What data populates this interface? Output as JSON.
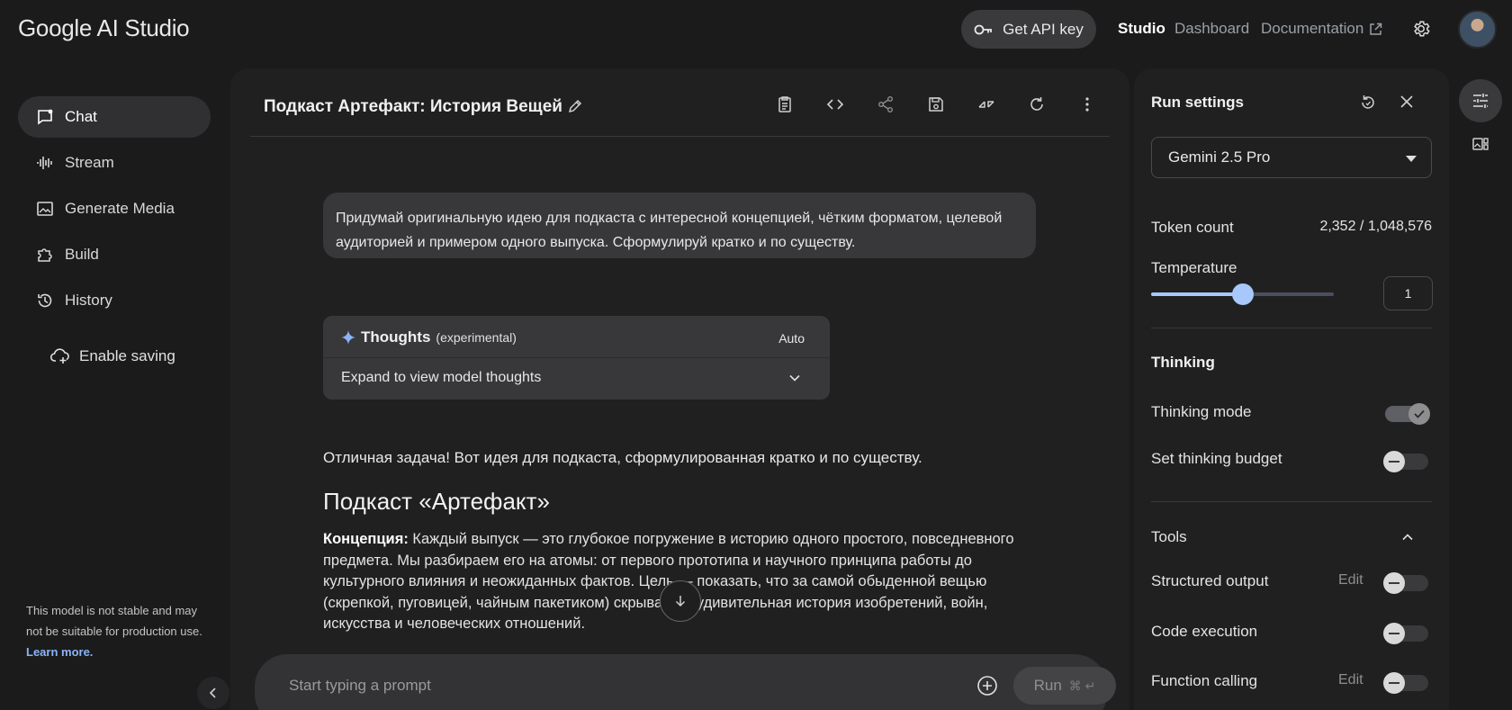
{
  "app": {
    "title": "Google AI Studio"
  },
  "header": {
    "api_key_label": "Get API key",
    "nav": [
      {
        "label": "Studio",
        "active": true
      },
      {
        "label": "Dashboard",
        "active": false
      },
      {
        "label": "Documentation",
        "active": false
      }
    ]
  },
  "sidebar": {
    "items": [
      {
        "label": "Chat",
        "icon": "chat-icon",
        "active": true
      },
      {
        "label": "Stream",
        "icon": "waveform-icon",
        "active": false
      },
      {
        "label": "Generate Media",
        "icon": "image-icon",
        "active": false
      },
      {
        "label": "Build",
        "icon": "puzzle-icon",
        "active": false
      },
      {
        "label": "History",
        "icon": "history-icon",
        "active": false
      }
    ],
    "enable_saving": "Enable saving",
    "disclaimer": "This model is not stable and may not be suitable for production use.",
    "learn_more": "Learn more."
  },
  "chat": {
    "title": "Подкаст Артефакт: История Вещей",
    "user_message": "Придумай оригинальную идею для подкаста с интересной концепцией, чётким форматом, целевой аудиторией и примером одного выпуска. Сформулируй кратко и по существу.",
    "thoughts": {
      "title": "Thoughts",
      "subtitle": "(experimental)",
      "mode": "Auto",
      "expand_label": "Expand to view model thoughts"
    },
    "answer": {
      "intro": "Отличная задача! Вот идея для подкаста, сформулированная кратко и по существу.",
      "heading": "Подкаст «Артефакт»",
      "concept_label": "Концепция:",
      "concept_text": " Каждый выпуск — это глубокое погружение в историю одного простого, повседневного предмета. Мы разбираем его на атомы: от первого прототипа и научного принципа работы до культурного влияния и неожиданных фактов. Цель — показать, что за самой обыденной вещью (скрепкой, пуговицей, чайным пакетиком) скрывается удивительная история изобретений, войн, искусства и человеческих отношений."
    },
    "prompt": {
      "placeholder": "Start typing a prompt",
      "run_label": "Run",
      "run_shortcut": "⌘ ↵"
    }
  },
  "run_settings": {
    "title": "Run settings",
    "model": "Gemini 2.5 Pro",
    "token_count_label": "Token count",
    "token_count_value": "2,352 / 1,048,576",
    "temperature_label": "Temperature",
    "temperature_value": "1",
    "temperature_fraction": 0.5,
    "thinking_heading": "Thinking",
    "thinking_mode_label": "Thinking mode",
    "thinking_mode_on": true,
    "thinking_budget_label": "Set thinking budget",
    "thinking_budget_on": false,
    "tools_heading": "Tools",
    "tools": [
      {
        "label": "Structured output",
        "edit": "Edit",
        "on": false
      },
      {
        "label": "Code execution",
        "edit": "",
        "on": false
      },
      {
        "label": "Function calling",
        "edit": "Edit",
        "on": false
      }
    ]
  },
  "colors": {
    "background": "#1b1b1c",
    "panel": "#202021",
    "accent": "#a8c7fa",
    "link": "#8ab4f8"
  }
}
